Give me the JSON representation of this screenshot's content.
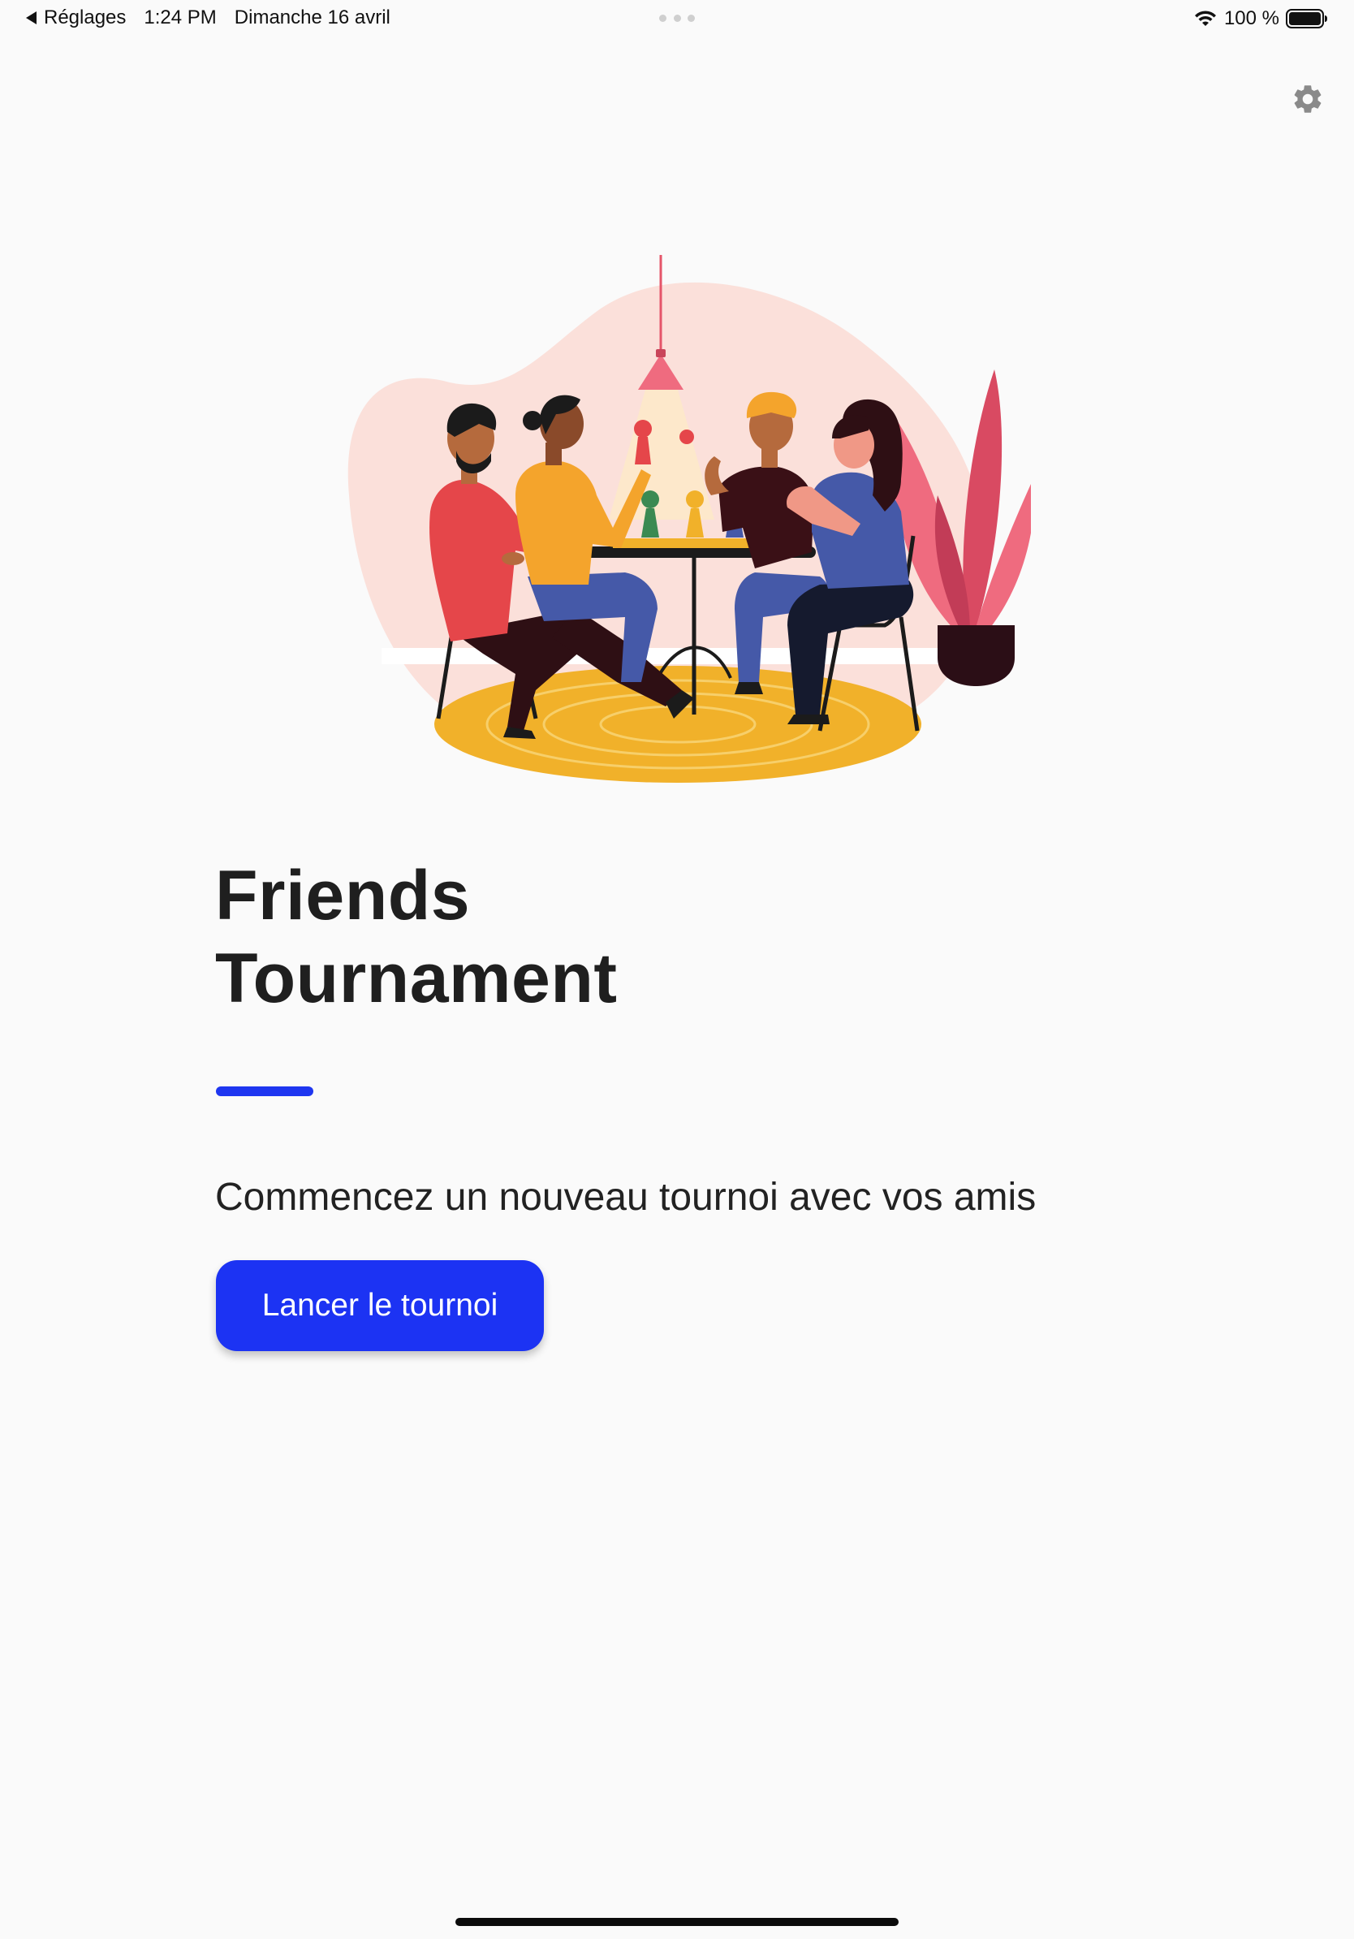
{
  "status_bar": {
    "back_label": "Réglages",
    "time": "1:24 PM",
    "date": "Dimanche 16 avril",
    "battery": "100 %"
  },
  "icons": {
    "settings": "gear-icon",
    "wifi": "wifi-icon",
    "battery": "battery-icon",
    "back": "back-arrow-icon"
  },
  "home": {
    "title_line1": "Friends",
    "title_line2": "Tournament",
    "subtitle": "Commencez un nouveau tournoi avec vos amis",
    "launch_button": "Lancer le tournoi"
  },
  "colors": {
    "accent": "#1c33f3",
    "background": "#fafafa",
    "rug": "#f1b12a",
    "blob": "#fbe0da"
  }
}
